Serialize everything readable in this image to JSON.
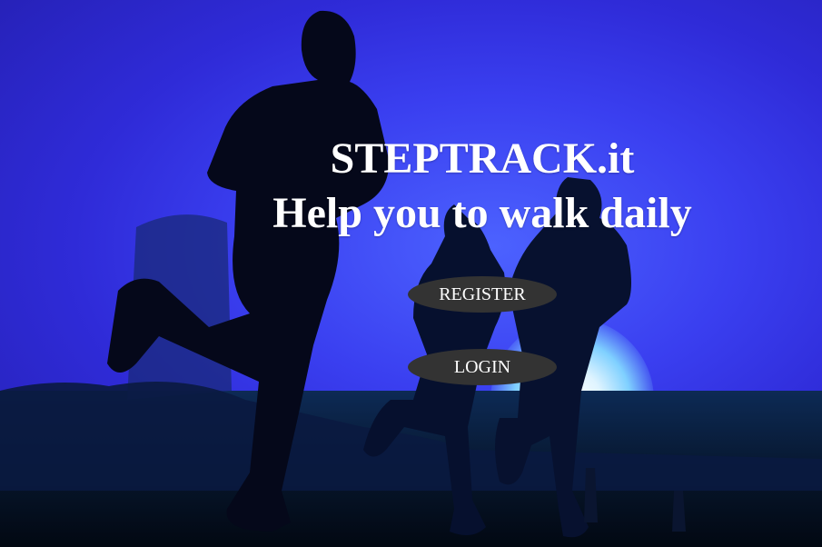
{
  "header": {
    "brand": "STEPTRACK.it",
    "tagline": "Help you to walk daily"
  },
  "actions": {
    "register_label": "REGISTER",
    "login_label": "LOGIN"
  },
  "colors": {
    "background_blue": "#3a3ff0",
    "button_fill": "#333333",
    "text": "#ffffff"
  }
}
